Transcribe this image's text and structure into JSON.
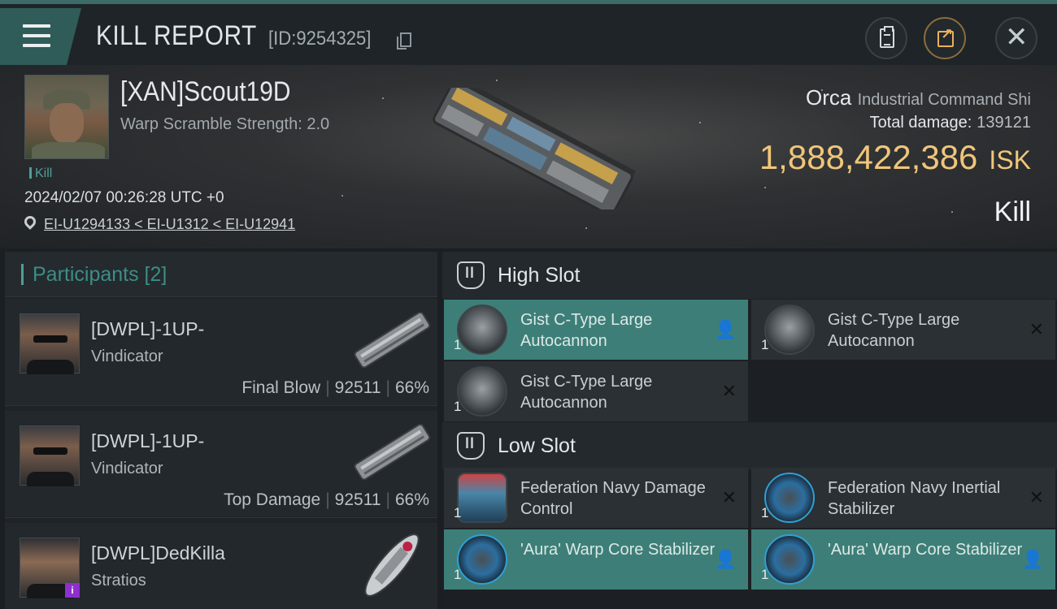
{
  "header": {
    "title": "KILL REPORT",
    "report_id": "[ID:9254325]",
    "menu_icon": "hamburger-menu-icon",
    "copy_icon": "copy-icon",
    "report_icon": "clipboard-icon",
    "share_icon": "share-icon",
    "close_icon": "close-icon",
    "close_glyph": "✕"
  },
  "victim": {
    "name": "[XAN]Scout19D",
    "subtitle": "Warp Scramble Strength: 2.0",
    "tag": "Kill",
    "timestamp": "2024/02/07 00:26:28 UTC +0",
    "location": "EI-U1294133 < EI-U1312 < EI-U12941",
    "ship_name": "Orca",
    "ship_class": "Industrial Command Shi",
    "total_damage_label": "Total damage:",
    "total_damage": "139121",
    "isk_value": "1,888,422,386",
    "isk_unit": "ISK",
    "result": "Kill"
  },
  "participants": {
    "header": "Participants [2]",
    "rows": [
      {
        "name": "[DWPL]-1UP-",
        "ship": "Vindicator",
        "role": "Final Blow",
        "damage": "92511",
        "percent": "66%"
      },
      {
        "name": "[DWPL]-1UP-",
        "ship": "Vindicator",
        "role": "Top Damage",
        "damage": "92511",
        "percent": "66%"
      },
      {
        "name": "[DWPL]DedKilla",
        "ship": "Stratios",
        "badge": "i"
      }
    ]
  },
  "fitting": {
    "high_slot_label": "High Slot",
    "low_slot_label": "Low Slot",
    "high_slot": [
      {
        "qty": "1",
        "name": "Gist C-Type Large Autocannon",
        "status": "dropped"
      },
      {
        "qty": "1",
        "name": "Gist C-Type Large Autocannon",
        "status": "destroyed"
      },
      {
        "qty": "1",
        "name": "Gist C-Type Large Autocannon",
        "status": "destroyed"
      }
    ],
    "low_slot": [
      {
        "qty": "1",
        "name": "Federation Navy Damage Control",
        "status": "destroyed"
      },
      {
        "qty": "1",
        "name": "Federation Navy Inertial Stabilizer",
        "status": "destroyed"
      },
      {
        "qty": "1",
        "name": "'Aura' Warp Core Stabilizer",
        "status": "dropped"
      },
      {
        "qty": "1",
        "name": "'Aura' Warp Core Stabilizer",
        "status": "dropped"
      }
    ],
    "status_glyphs": {
      "destroyed": "✕",
      "dropped": "👤"
    }
  },
  "colors": {
    "accent": "#3d7f78",
    "isk": "#f0c67a",
    "background": "#1b1f23"
  }
}
